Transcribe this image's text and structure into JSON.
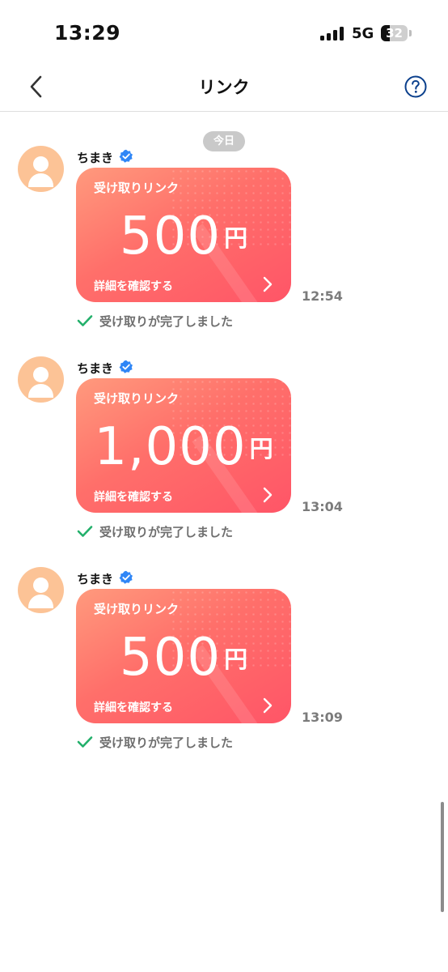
{
  "status_bar": {
    "time": "13:29",
    "network": "5G",
    "battery": "32",
    "battery_level": 0.32
  },
  "nav": {
    "title": "リンク",
    "back_icon": "chevron-left-icon",
    "help_icon": "question-circle-icon"
  },
  "date_chip": "今日",
  "messages": [
    {
      "sender": "ちまき",
      "card_title": "受け取りリンク",
      "amount": "500",
      "currency": "円",
      "detail_label": "詳細を確認する",
      "time": "12:54",
      "status": "受け取りが完了しました"
    },
    {
      "sender": "ちまき",
      "card_title": "受け取りリンク",
      "amount": "1,000",
      "currency": "円",
      "detail_label": "詳細を確認する",
      "time": "13:04",
      "status": "受け取りが完了しました"
    },
    {
      "sender": "ちまき",
      "card_title": "受け取りリンク",
      "amount": "500",
      "currency": "円",
      "detail_label": "詳細を確認する",
      "time": "13:09",
      "status": "受け取りが完了しました"
    }
  ],
  "colors": {
    "accent_blue": "#0a3f8c",
    "verified_blue": "#2f86f6",
    "card_gradient_start": "#ff9a7d",
    "card_gradient_end": "#ff5567",
    "avatar_bg": "#fcc396",
    "check_green": "#23b06b"
  }
}
